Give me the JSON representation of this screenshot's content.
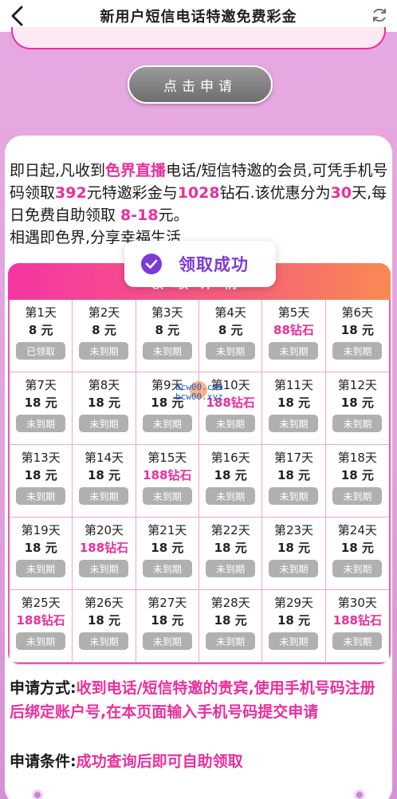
{
  "header": {
    "title": "新用户短信电话特邀免费彩金"
  },
  "apply_button": "点击申请",
  "intro": {
    "p1": "即日起,凡收到",
    "h1": "色界直播",
    "p2": "电话/短信特邀的会员,可凭手机号码领取",
    "h2": "392",
    "p3": "元特邀彩金与",
    "h3": "1028",
    "p4": "钻石.该优惠分为",
    "h4": "30",
    "p5": "天,每日免费自助领取 ",
    "h5": "8-18",
    "p6": "元。",
    "p7": "相遇即色界,分享幸福生活"
  },
  "grid_title": "领取详情",
  "toast": {
    "text": "领取成功"
  },
  "watermark": {
    "line1": "bcw00.com",
    "line2": "bcw00.xyz"
  },
  "days": [
    {
      "day": "第1天",
      "reward": "8 元",
      "status": "已领取",
      "pink": false
    },
    {
      "day": "第2天",
      "reward": "8 元",
      "status": "未到期",
      "pink": false
    },
    {
      "day": "第3天",
      "reward": "8 元",
      "status": "未到期",
      "pink": false
    },
    {
      "day": "第4天",
      "reward": "8 元",
      "status": "未到期",
      "pink": false
    },
    {
      "day": "第5天",
      "reward": "88钻石",
      "status": "未到期",
      "pink": true
    },
    {
      "day": "第6天",
      "reward": "18 元",
      "status": "未到期",
      "pink": false
    },
    {
      "day": "第7天",
      "reward": "18 元",
      "status": "未到期",
      "pink": false
    },
    {
      "day": "第8天",
      "reward": "18 元",
      "status": "未到期",
      "pink": false
    },
    {
      "day": "第9天",
      "reward": "18 元",
      "status": "未到期",
      "pink": false
    },
    {
      "day": "第10天",
      "reward": "188钻石",
      "status": "未到期",
      "pink": true
    },
    {
      "day": "第11天",
      "reward": "18 元",
      "status": "未到期",
      "pink": false
    },
    {
      "day": "第12天",
      "reward": "18 元",
      "status": "未到期",
      "pink": false
    },
    {
      "day": "第13天",
      "reward": "18 元",
      "status": "未到期",
      "pink": false
    },
    {
      "day": "第14天",
      "reward": "18 元",
      "status": "未到期",
      "pink": false
    },
    {
      "day": "第15天",
      "reward": "188钻石",
      "status": "未到期",
      "pink": true
    },
    {
      "day": "第16天",
      "reward": "18 元",
      "status": "未到期",
      "pink": false
    },
    {
      "day": "第17天",
      "reward": "18 元",
      "status": "未到期",
      "pink": false
    },
    {
      "day": "第18天",
      "reward": "18 元",
      "status": "未到期",
      "pink": false
    },
    {
      "day": "第19天",
      "reward": "18 元",
      "status": "未到期",
      "pink": false
    },
    {
      "day": "第20天",
      "reward": "188钻石",
      "status": "未到期",
      "pink": true
    },
    {
      "day": "第21天",
      "reward": "18 元",
      "status": "未到期",
      "pink": false
    },
    {
      "day": "第22天",
      "reward": "18 元",
      "status": "未到期",
      "pink": false
    },
    {
      "day": "第23天",
      "reward": "18 元",
      "status": "未到期",
      "pink": false
    },
    {
      "day": "第24天",
      "reward": "18 元",
      "status": "未到期",
      "pink": false
    },
    {
      "day": "第25天",
      "reward": "188钻石",
      "status": "未到期",
      "pink": true
    },
    {
      "day": "第26天",
      "reward": "18 元",
      "status": "未到期",
      "pink": false
    },
    {
      "day": "第27天",
      "reward": "18 元",
      "status": "未到期",
      "pink": false
    },
    {
      "day": "第28天",
      "reward": "18 元",
      "status": "未到期",
      "pink": false
    },
    {
      "day": "第29天",
      "reward": "18 元",
      "status": "未到期",
      "pink": false
    },
    {
      "day": "第30天",
      "reward": "188钻石",
      "status": "未到期",
      "pink": true
    }
  ],
  "apply_method": {
    "label": "申请方式:",
    "value": "收到电话/短信特邀的贵宾,使用手机号码注册后绑定账户号,在本页面输入手机号码提交申请"
  },
  "apply_condition": {
    "label": "申请条件:",
    "value": "成功查询后即可自助领取"
  },
  "colors": {
    "accent": "#ea2f9d",
    "toast_text": "#7a3bd6",
    "status_bg": "#b0b0b0"
  },
  "icons": {
    "back": "chevron-left-icon",
    "refresh": "refresh-icon",
    "check": "check-circle-icon"
  }
}
